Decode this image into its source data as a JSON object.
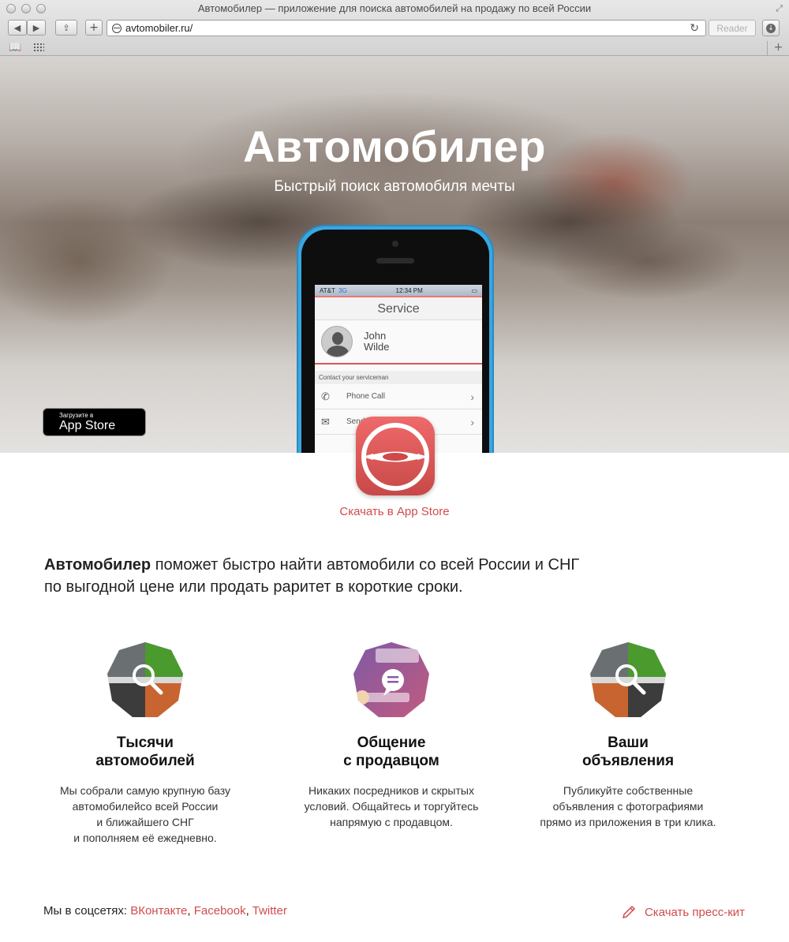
{
  "window": {
    "title": "Автомобилер — приложение для поиска автомобилей на продажу по всей России",
    "url": "avtomobiler.ru/",
    "reader_label": "Reader"
  },
  "hero": {
    "title": "Автомобилер",
    "subtitle": "Быстрый поиск автомобиля мечты"
  },
  "phone_screen": {
    "carrier": "AT&T",
    "network": "3G",
    "time": "12:34 PM",
    "header": "Service",
    "contact_first": "John",
    "contact_last": "Wilde",
    "section_label": "Contact your serviceman",
    "rows": [
      {
        "label": "Phone Call",
        "icon": "phone-icon"
      },
      {
        "label": "Send",
        "icon": "mail-icon"
      }
    ]
  },
  "appstore_badge": {
    "small": "Загрузите в",
    "big": "App Store"
  },
  "download_link": "Скачать в App Store",
  "intro": {
    "brand": "Автомобилер",
    "line1": " поможет быстро найти автомобили со всей России и СНГ",
    "line2": "по выгодной цене или продать раритет в короткие сроки."
  },
  "features": [
    {
      "title1": "Тысячи",
      "title2": "автомобилей",
      "text": [
        "Мы собрали самую крупную базу",
        "автомобилейсо всей России",
        "и ближайшего СНГ",
        "и пополняем её ежедневно."
      ],
      "icon": "search-icon"
    },
    {
      "title1": "Общение",
      "title2": "с продавцом",
      "text": [
        "Никаких посредников и скрытых",
        "условий. Общайтесь и торгуйтесь",
        "напрямую с продавцом."
      ],
      "icon": "chat-icon"
    },
    {
      "title1": "Ваши",
      "title2": "объявления",
      "text": [
        "Публикуйте собственные",
        "объявления с фотографиями",
        "прямо из приложения в три клика."
      ],
      "icon": "search-icon"
    }
  ],
  "footer": {
    "social_label": "Мы в соцсетях:",
    "links": [
      "ВКонтакте",
      "Facebook",
      "Twitter"
    ],
    "press_kit": "Скачать пресс-кит"
  },
  "colors": {
    "accent": "#d24b4b",
    "icon_red": "#e05a5a",
    "phone_blue": "#3aa6e0"
  }
}
